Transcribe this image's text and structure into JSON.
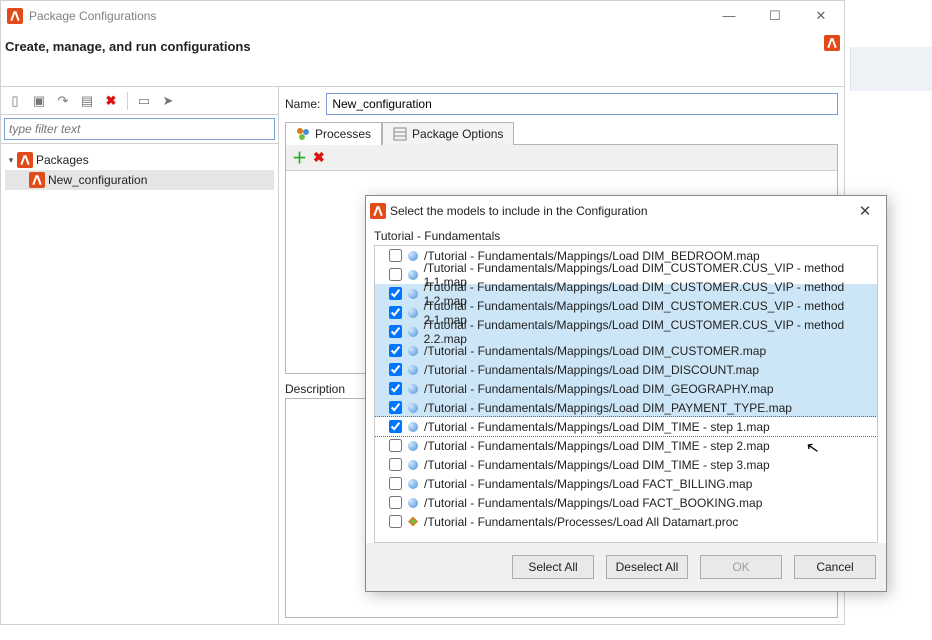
{
  "window": {
    "title": "Package Configurations",
    "header": "Create, manage, and run configurations",
    "min_glyph": "—",
    "max_glyph": "☐",
    "close_glyph": "✕"
  },
  "sidebar": {
    "filter_placeholder": "type filter text",
    "root_label": "Packages",
    "item_label": "New_configuration"
  },
  "form": {
    "name_label": "Name:",
    "name_value": "New_configuration",
    "tab1": "Processes",
    "tab2": "Package Options",
    "desc_label": "Description"
  },
  "modal": {
    "title": "Select the models to include in the Configuration",
    "group": "Tutorial - Fundamentals",
    "rows": [
      {
        "checked": false,
        "sel": false,
        "focus": false,
        "kind": "map",
        "label": "/Tutorial - Fundamentals/Mappings/Load DIM_BEDROOM.map"
      },
      {
        "checked": false,
        "sel": false,
        "focus": false,
        "kind": "map",
        "label": "/Tutorial - Fundamentals/Mappings/Load DIM_CUSTOMER.CUS_VIP - method 1.1.map"
      },
      {
        "checked": true,
        "sel": true,
        "focus": false,
        "kind": "map",
        "label": "/Tutorial - Fundamentals/Mappings/Load DIM_CUSTOMER.CUS_VIP - method 1.2.map"
      },
      {
        "checked": true,
        "sel": true,
        "focus": false,
        "kind": "map",
        "label": "/Tutorial - Fundamentals/Mappings/Load DIM_CUSTOMER.CUS_VIP - method 2.1.map"
      },
      {
        "checked": true,
        "sel": true,
        "focus": false,
        "kind": "map",
        "label": "/Tutorial - Fundamentals/Mappings/Load DIM_CUSTOMER.CUS_VIP - method 2.2.map"
      },
      {
        "checked": true,
        "sel": true,
        "focus": false,
        "kind": "map",
        "label": "/Tutorial - Fundamentals/Mappings/Load DIM_CUSTOMER.map"
      },
      {
        "checked": true,
        "sel": true,
        "focus": false,
        "kind": "map",
        "label": "/Tutorial - Fundamentals/Mappings/Load DIM_DISCOUNT.map"
      },
      {
        "checked": true,
        "sel": true,
        "focus": false,
        "kind": "map",
        "label": "/Tutorial - Fundamentals/Mappings/Load DIM_GEOGRAPHY.map"
      },
      {
        "checked": true,
        "sel": true,
        "focus": false,
        "kind": "map",
        "label": "/Tutorial - Fundamentals/Mappings/Load DIM_PAYMENT_TYPE.map"
      },
      {
        "checked": true,
        "sel": false,
        "focus": true,
        "kind": "map",
        "label": "/Tutorial - Fundamentals/Mappings/Load DIM_TIME - step 1.map"
      },
      {
        "checked": false,
        "sel": false,
        "focus": false,
        "kind": "map",
        "label": "/Tutorial - Fundamentals/Mappings/Load DIM_TIME - step 2.map"
      },
      {
        "checked": false,
        "sel": false,
        "focus": false,
        "kind": "map",
        "label": "/Tutorial - Fundamentals/Mappings/Load DIM_TIME - step 3.map"
      },
      {
        "checked": false,
        "sel": false,
        "focus": false,
        "kind": "map",
        "label": "/Tutorial - Fundamentals/Mappings/Load FACT_BILLING.map"
      },
      {
        "checked": false,
        "sel": false,
        "focus": false,
        "kind": "map",
        "label": "/Tutorial - Fundamentals/Mappings/Load FACT_BOOKING.map"
      },
      {
        "checked": false,
        "sel": false,
        "focus": false,
        "kind": "proc",
        "label": "/Tutorial - Fundamentals/Processes/Load All Datamart.proc"
      }
    ],
    "buttons": {
      "select_all": "Select All",
      "deselect_all": "Deselect All",
      "ok": "OK",
      "cancel": "Cancel"
    }
  }
}
